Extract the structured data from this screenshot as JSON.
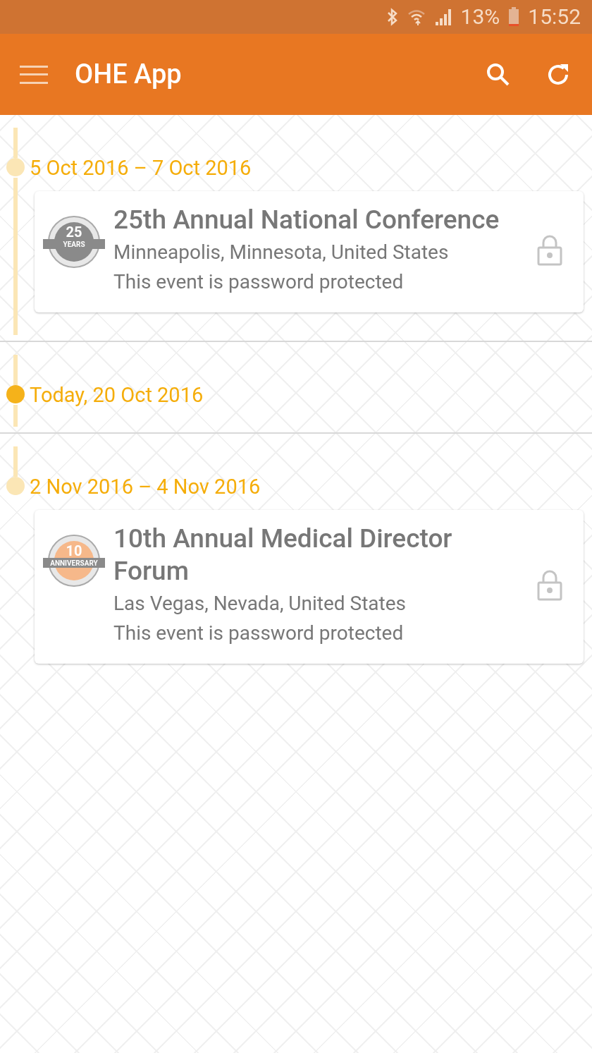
{
  "status_bar": {
    "battery": "13%",
    "time": "15:52"
  },
  "app_bar": {
    "title": "OHE App"
  },
  "sections": [
    {
      "date": "5 Oct 2016 – 7 Oct 2016",
      "today": false,
      "rail_continues": true,
      "events": [
        {
          "color": "#8a8a8a",
          "logo_number": "25",
          "logo_word": "YEARS",
          "title": "25th Annual National Conference",
          "location": "Minneapolis, Minnesota, United States",
          "note": "This event is password protected",
          "locked": true
        }
      ]
    },
    {
      "date": "Today, 20 Oct 2016",
      "today": true,
      "rail_continues": true
    },
    {
      "date": "2 Nov 2016 – 4 Nov 2016",
      "today": false,
      "rail_continues": false,
      "events": [
        {
          "color": "#f6b88a",
          "logo_number": "10",
          "logo_word": "ANNIVERSARY",
          "title": "10th Annual Medical Director Forum",
          "location": "Las Vegas, Nevada, United States",
          "note": "This event is password protected",
          "locked": true
        }
      ]
    }
  ]
}
